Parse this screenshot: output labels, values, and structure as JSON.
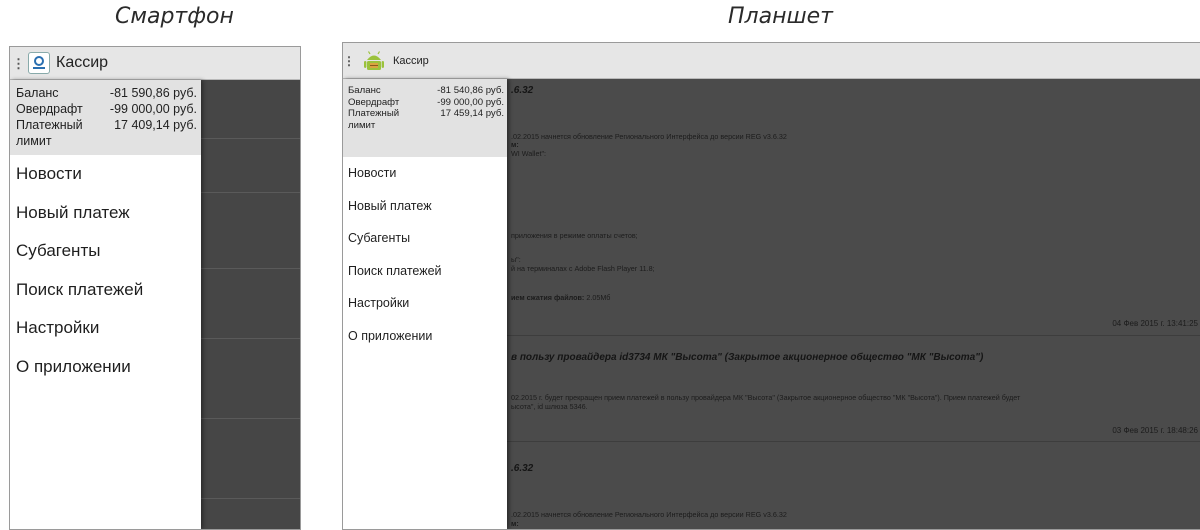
{
  "captions": {
    "phone": "Смартфон",
    "tablet": "Планшет"
  },
  "app": {
    "title": "Кассир"
  },
  "balance": {
    "phone": [
      {
        "label": "Баланс",
        "value": "-81 590,86 руб."
      },
      {
        "label": "Овердрафт",
        "value": "-99 000,00 руб."
      },
      {
        "label": "Платежный",
        "value": "17 409,14 руб."
      }
    ],
    "phone_extra": "лимит",
    "tablet": [
      {
        "label": "Баланс",
        "value": "-81 540,86 руб."
      },
      {
        "label": "Овердрафт",
        "value": "-99 000,00 руб."
      },
      {
        "label": "Платежный",
        "value": "17 459,14 руб."
      }
    ],
    "tablet_extra": "лимит"
  },
  "menu": [
    "Новости",
    "Новый платеж",
    "Субагенты",
    "Поиск платежей",
    "Настройки",
    "О приложении"
  ],
  "news": {
    "n1_title": ".6.32",
    "n1_line1": ".02.2015 начнется обновление Регионального Интерфейса до версии REG v3.6.32",
    "n1_line2": "м:",
    "n1_line3": "WI Wallet\":",
    "n1_line4": "приложения в режиме оплаты счетов;",
    "n1_line5": "ы\":",
    "n1_line6": "й на терминалах с Adobe Flash Player 11.8;",
    "n1_line7_bold": "ием сжатия файлов:",
    "n1_line7_val": " 2.05Мб",
    "n1_date": "04 Фев 2015 г. 13:41:25",
    "n2_title": "в пользу провайдера id3734 МК \"Высота\" (Закрытое акционерное общество \"МК \"Высота\")",
    "n2_line1": "02.2015 г. будет прекращен прием платежей в пользу провайдера МК \"Высота\" (Закрытое акционерное общество \"МК \"Высота\"). Прием платежей будет",
    "n2_line2": "ысота\", id шлюза 5346.",
    "n2_date": "03 Фев 2015 г. 18:48:26",
    "n3_title": ".6.32",
    "n3_line1": ".02.2015 начнется обновление Регионального Интерфейса до версии REG v3.6.32",
    "n3_line2": "м:"
  }
}
